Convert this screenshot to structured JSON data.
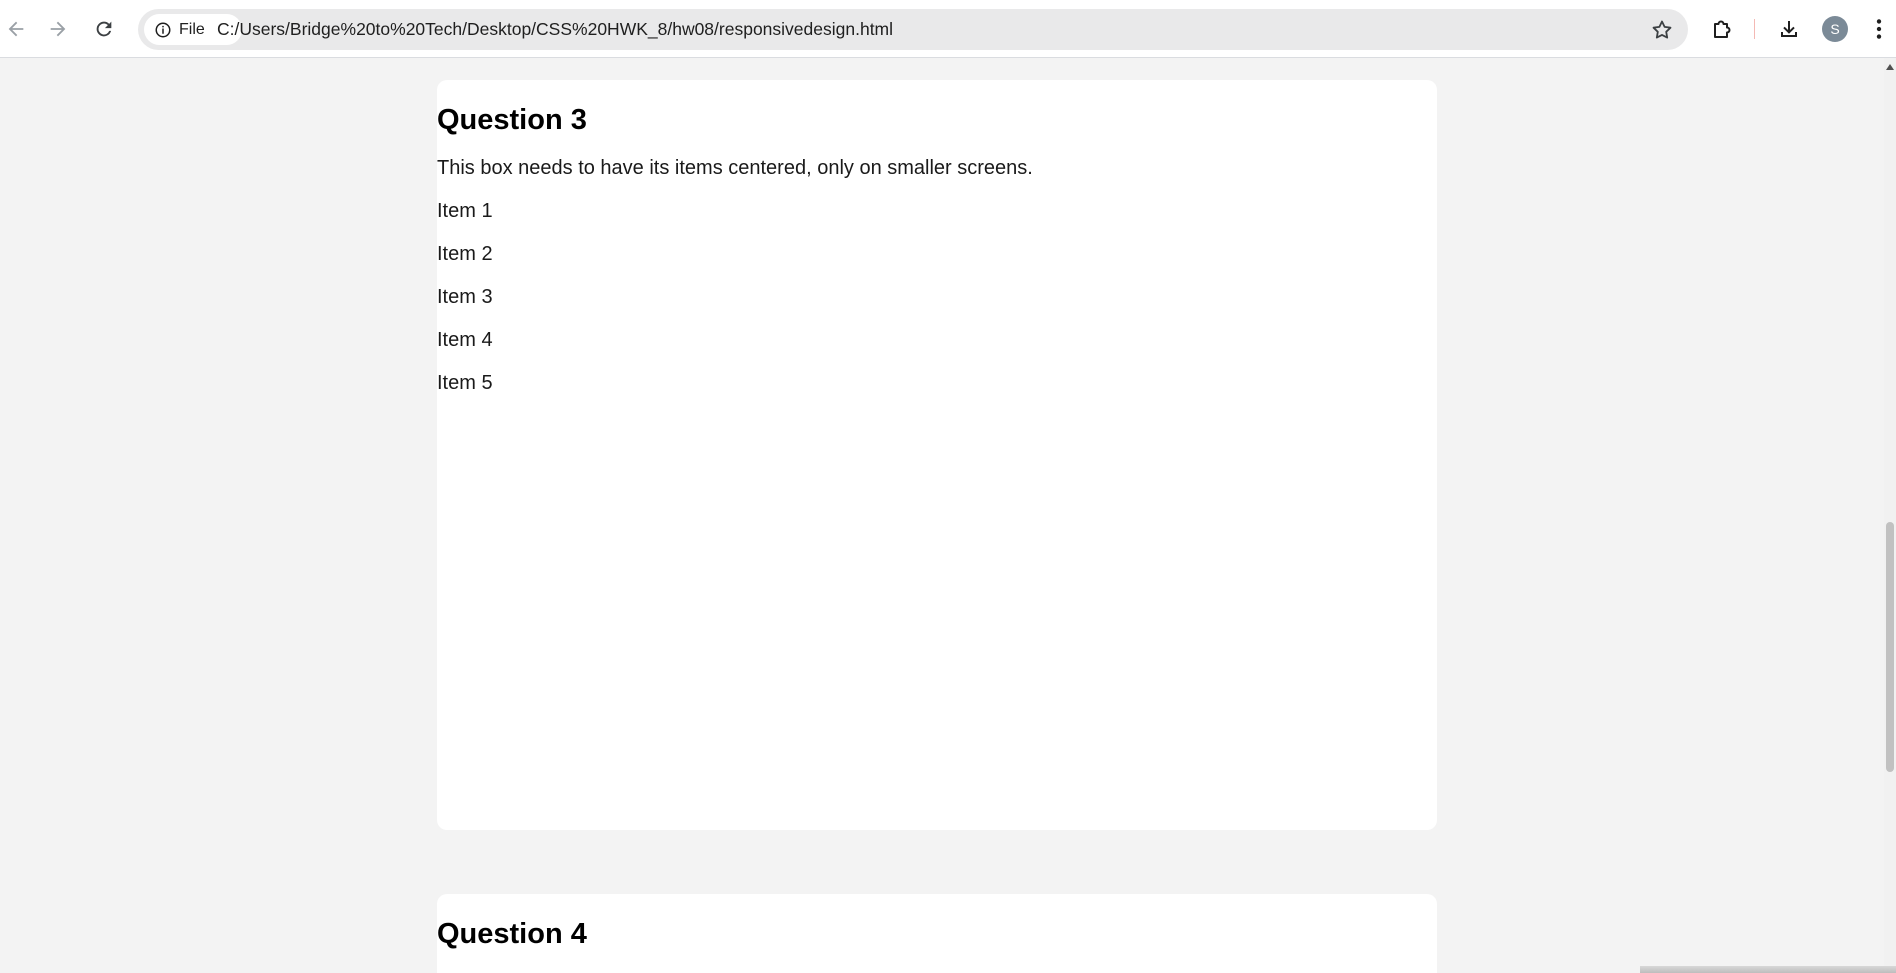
{
  "browser": {
    "chip_label": "File",
    "url": "C:/Users/Bridge%20to%20Tech/Desktop/CSS%20HWK_8/hw08/responsivedesign.html",
    "avatar_letter": "S",
    "icons": {
      "back": "arrow-left-icon",
      "forward": "arrow-right-icon",
      "reload": "reload-icon",
      "site_info": "info-icon",
      "bookmark": "star-icon",
      "extensions": "puzzle-icon",
      "downloads": "download-icon",
      "menu": "kebab-menu-icon"
    }
  },
  "page": {
    "question3": {
      "title": "Question 3",
      "description": "This box needs to have its items centered, only on smaller screens.",
      "items": [
        "Item 1",
        "Item 2",
        "Item 3",
        "Item 4",
        "Item 5"
      ]
    },
    "question4": {
      "title": "Question 4"
    }
  },
  "colors": {
    "page_background": "#f3f3f3",
    "card_background": "#ffffff",
    "omnibox_background": "#e9e9ea"
  }
}
